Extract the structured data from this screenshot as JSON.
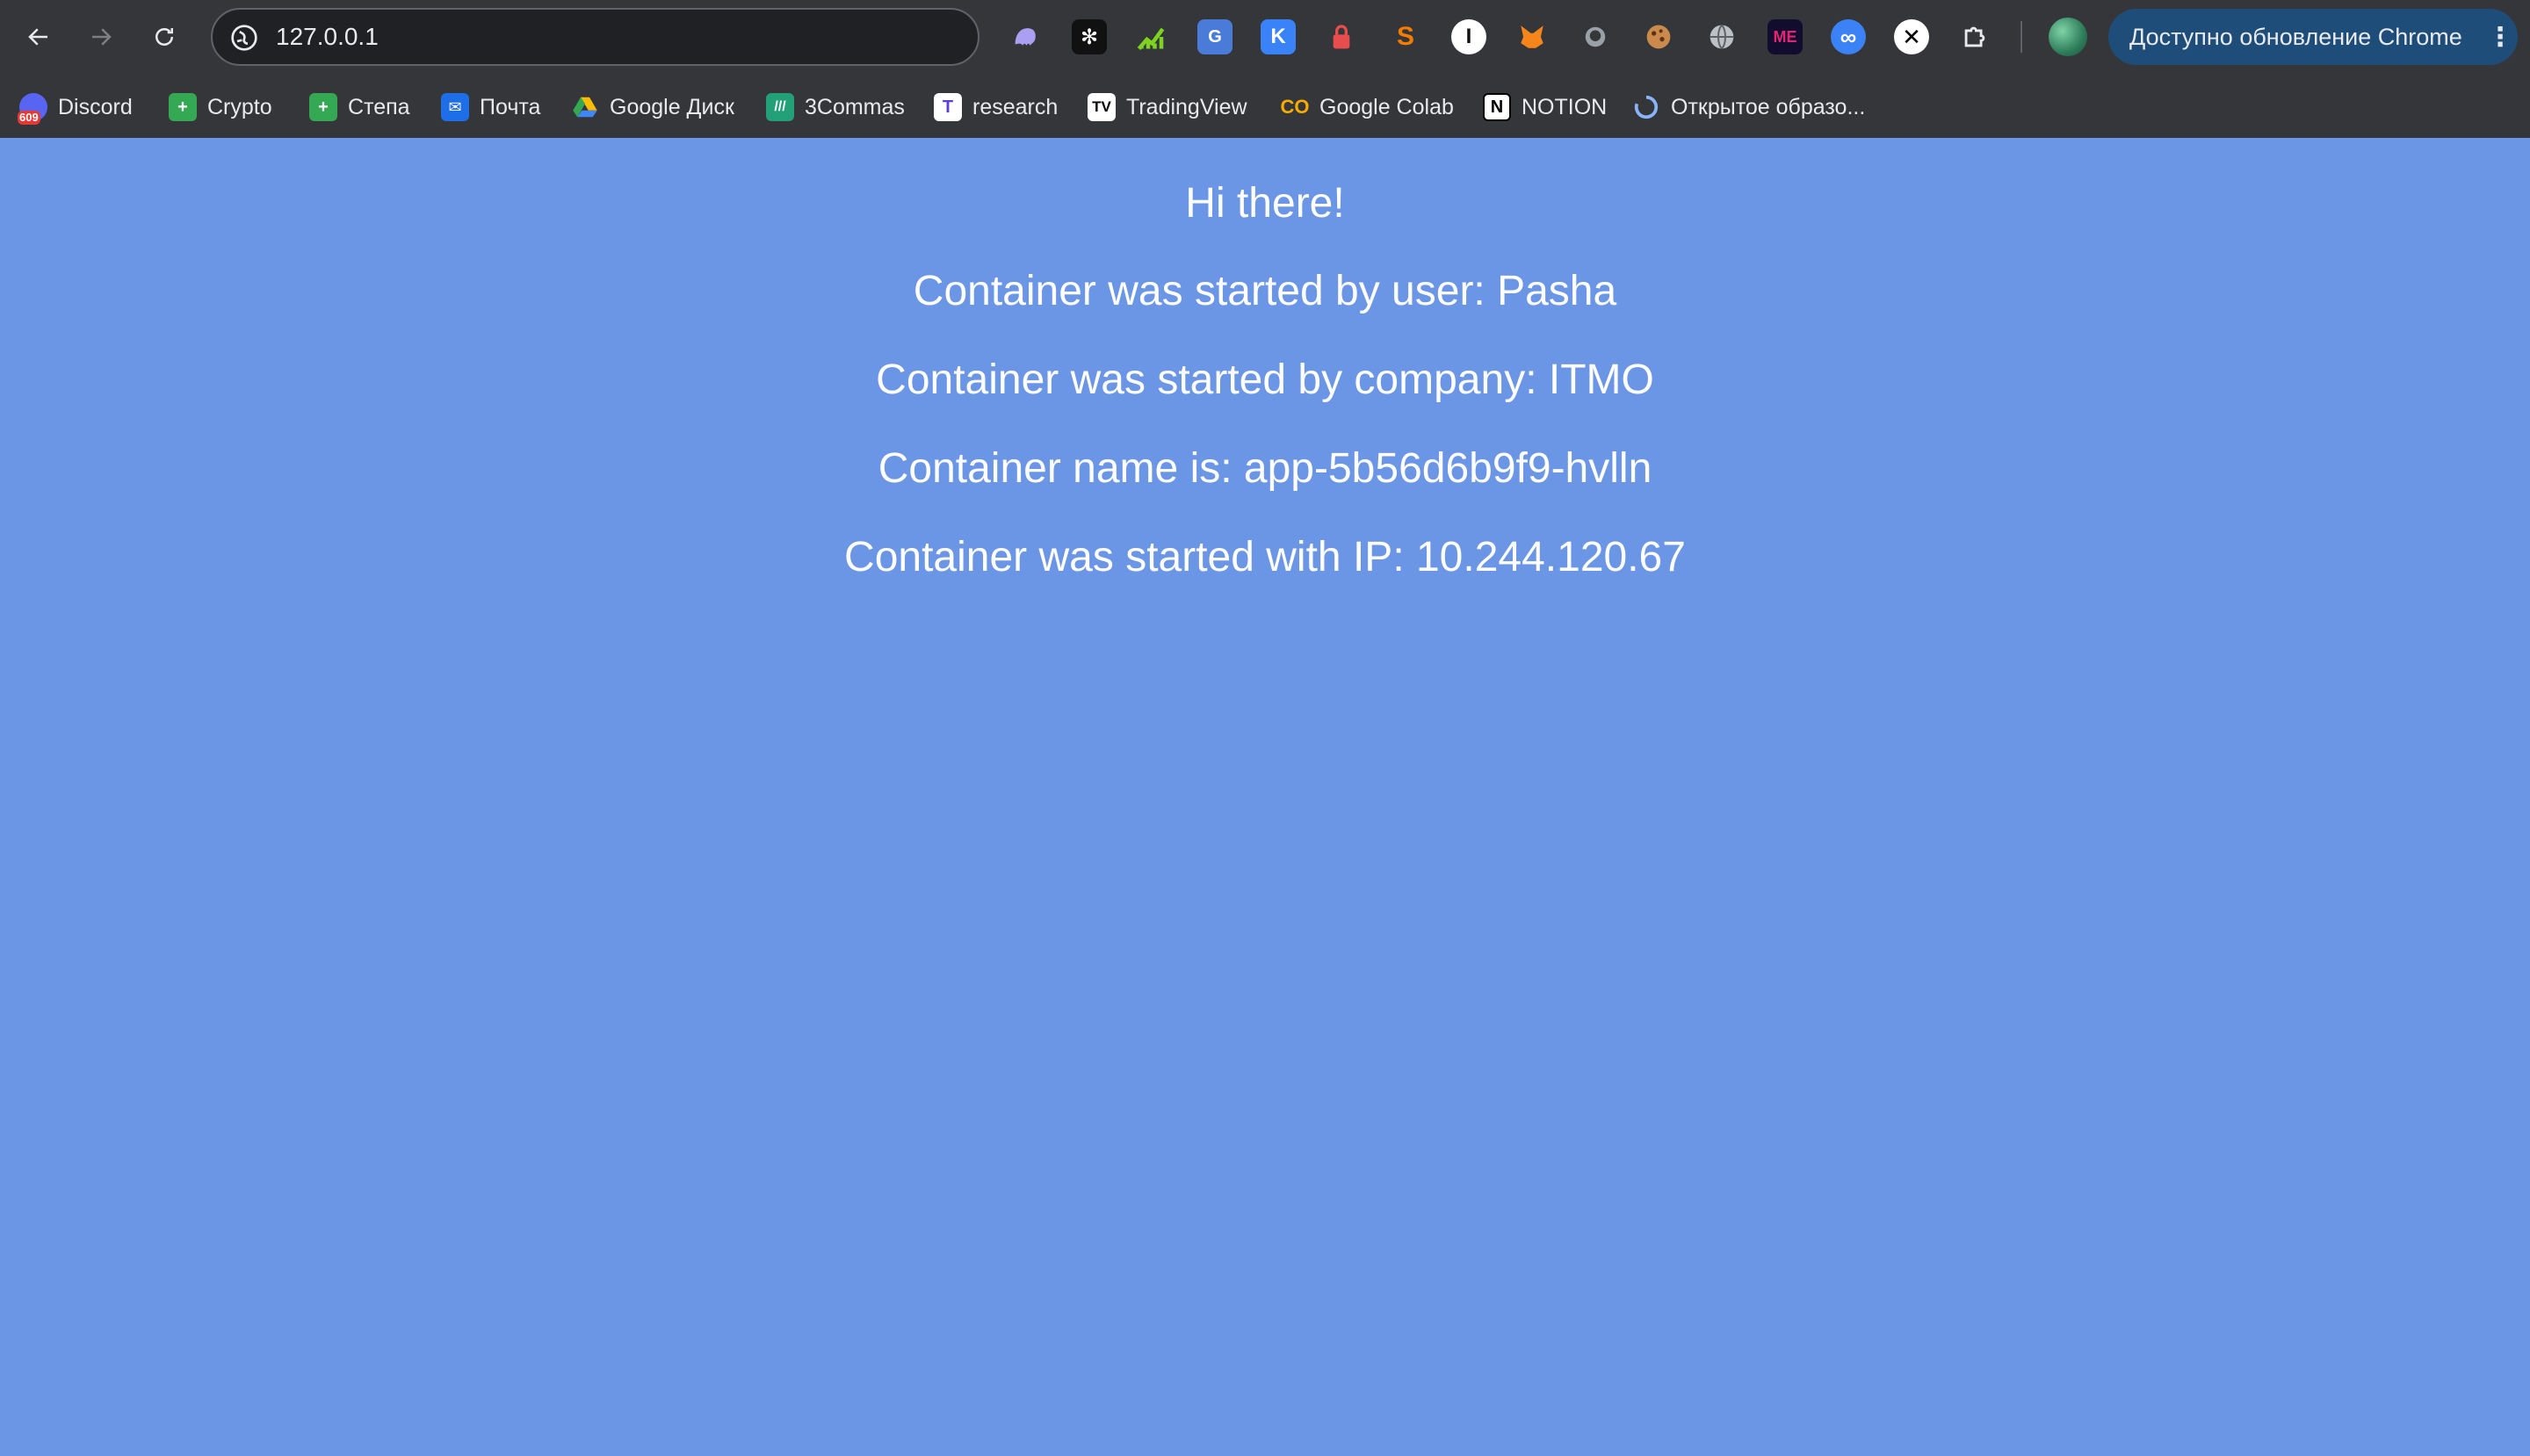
{
  "browser": {
    "url": "127.0.0.1",
    "update_button_label": "Доступно обновление Chrome",
    "extensions": [
      "ghost-extension-icon",
      "snowflake-extension-icon",
      "chart-extension-icon",
      "translate-extension-icon",
      "k-extension-icon",
      "lock-extension-icon",
      "s-extension-icon",
      "i-extension-icon",
      "metamask-fox-icon",
      "bird-extension-icon",
      "cookie-extension-icon",
      "globe-extension-icon",
      "me-extension-icon",
      "infinity-extension-icon",
      "x-extension-icon",
      "puzzle-extensions-icon"
    ]
  },
  "bookmarks": [
    {
      "label": "Discord",
      "badge": "609"
    },
    {
      "label": "Crypto"
    },
    {
      "label": "Степа"
    },
    {
      "label": "Почта"
    },
    {
      "label": "Google Диск"
    },
    {
      "label": "3Commas"
    },
    {
      "label": "research"
    },
    {
      "label": "TradingView"
    },
    {
      "label": "Google Colab"
    },
    {
      "label": "NOTION"
    },
    {
      "label": "Открытое образо..."
    }
  ],
  "page": {
    "greeting": "Hi there!",
    "user_line": "Container was started by user: Pasha",
    "company_line": "Container was started by company: ITMO",
    "name_line": "Container name is: app-5b56d6b9f9-hvlln",
    "ip_line": "Container was started with IP: 10.244.120.67"
  },
  "colors": {
    "page_background": "#6b95e5",
    "chrome_background": "#35363a",
    "update_button": "#1f4d7a"
  }
}
